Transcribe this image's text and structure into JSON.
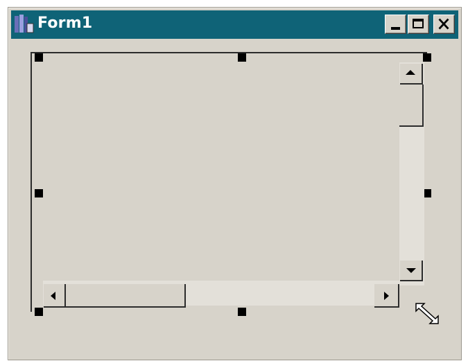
{
  "window": {
    "title": "Form1",
    "icons": {
      "app": "form-app-icon",
      "minimize": "minimize-icon",
      "maximize": "maximize-icon",
      "close": "close-icon"
    },
    "colors": {
      "titlebar": "#0f6377",
      "face": "#d7d3ca",
      "track": "#e3e0d9"
    }
  },
  "designer": {
    "control": "scrollable-panel",
    "selected": true,
    "scrollbars": {
      "vertical": {
        "up_icon": "arrow-up-icon",
        "down_icon": "arrow-down-icon"
      },
      "horizontal": {
        "left_icon": "arrow-left-icon",
        "right_icon": "arrow-right-icon"
      }
    },
    "resize_cursor_icon": "diagonal-resize-cursor-icon"
  }
}
